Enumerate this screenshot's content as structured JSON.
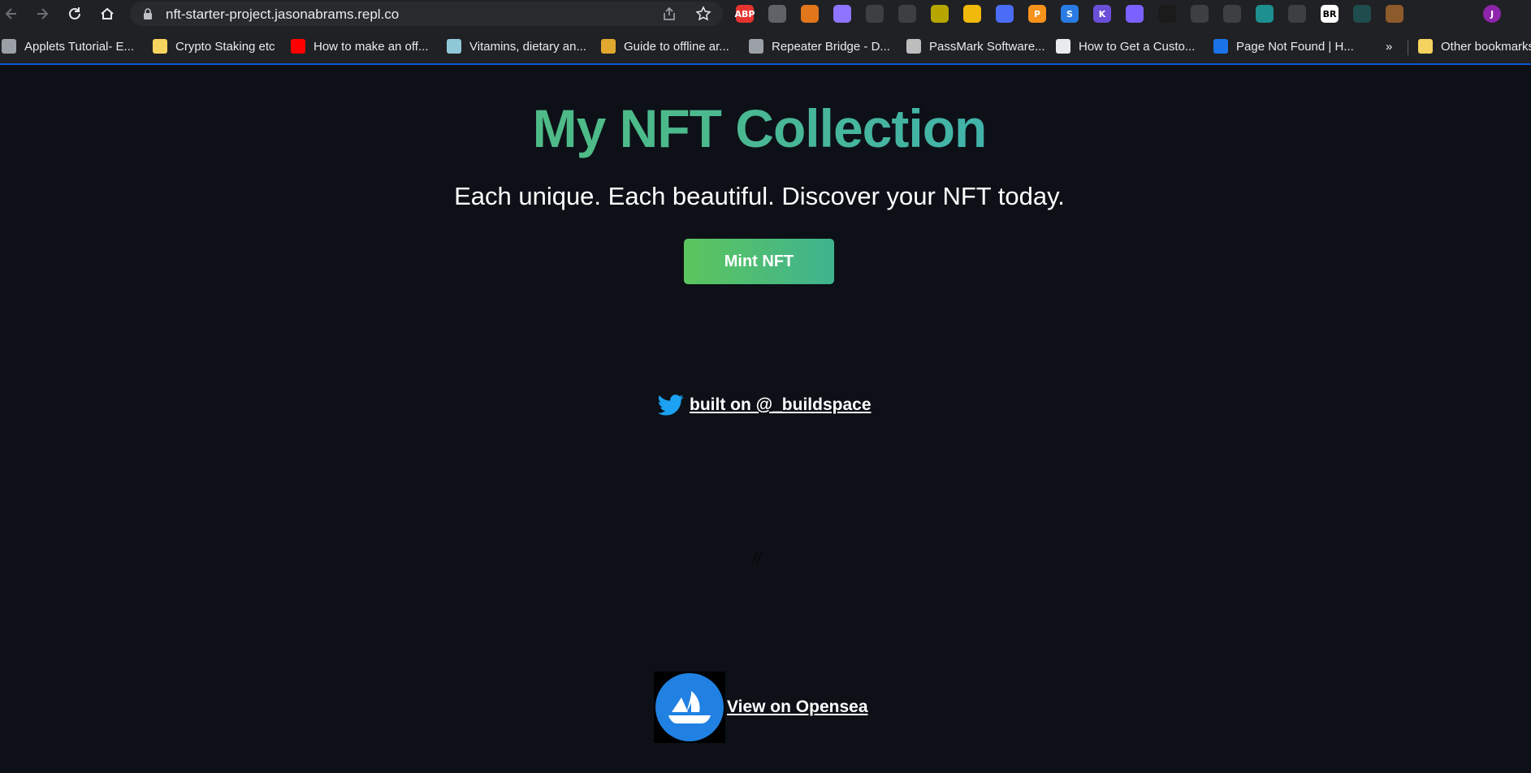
{
  "browser": {
    "url": "nft-starter-project.jasonabrams.repl.co",
    "extensions": [
      {
        "name": "adblock-plus-icon",
        "text": "ABP",
        "color": "#e5342f"
      },
      {
        "name": "extension-icon",
        "text": "",
        "color": "#5f6368"
      },
      {
        "name": "metamask-icon",
        "text": "",
        "color": "#e2761b"
      },
      {
        "name": "github-icon",
        "text": "",
        "color": "#8e75ff"
      },
      {
        "name": "extension-icon",
        "text": "",
        "color": "#3c4043"
      },
      {
        "name": "extension-icon",
        "text": "",
        "color": "#3c4043"
      },
      {
        "name": "extension-icon",
        "text": "",
        "color": "#b7a600"
      },
      {
        "name": "binance-icon",
        "text": "",
        "color": "#f0b90b"
      },
      {
        "name": "extension-icon",
        "text": "",
        "color": "#4a6cf7"
      },
      {
        "name": "extension-icon",
        "text": "P",
        "color": "#f7931a"
      },
      {
        "name": "extension-icon",
        "text": "S",
        "color": "#2a7be4"
      },
      {
        "name": "extension-icon",
        "text": "K",
        "color": "#6b4fd8"
      },
      {
        "name": "extension-icon",
        "text": "",
        "color": "#7b61ff"
      },
      {
        "name": "extension-icon",
        "text": "",
        "color": "#1b1b1b"
      },
      {
        "name": "extension-icon",
        "text": "",
        "color": "#3c4043"
      },
      {
        "name": "extension-icon",
        "text": "",
        "color": "#3c4043"
      },
      {
        "name": "extension-icon",
        "text": "",
        "color": "#1d8f8f"
      },
      {
        "name": "extension-icon",
        "text": "",
        "color": "#3c4043"
      },
      {
        "name": "extension-icon",
        "text": "BR",
        "color": "#ffffff"
      },
      {
        "name": "extension-icon",
        "text": "",
        "color": "#1f4c4c"
      },
      {
        "name": "extension-icon",
        "text": "",
        "color": "#8d5a2b"
      },
      {
        "name": "puzzle-icon",
        "text": "",
        "color": "#202124"
      },
      {
        "name": "side-panel-icon",
        "text": "",
        "color": "#202124"
      },
      {
        "name": "profile-avatar",
        "text": "J",
        "color": "#8e24aa"
      }
    ],
    "bookmarks": [
      {
        "label": "Applets Tutorial- E...",
        "color": "#9aa0a6"
      },
      {
        "label": "Crypto Staking etc",
        "color": "#f4d35e"
      },
      {
        "label": "How to make an off...",
        "color": "#ff0000"
      },
      {
        "label": "Vitamins, dietary an...",
        "color": "#8fc9d8"
      },
      {
        "label": "Guide to offline ar...",
        "color": "#e0a82e"
      },
      {
        "label": "Repeater Bridge - D...",
        "color": "#9aa0a6"
      },
      {
        "label": "PassMark Software...",
        "color": "#bdbdbd"
      },
      {
        "label": "How to Get a Custo...",
        "color": "#e8eaed"
      },
      {
        "label": "Page Not Found | H...",
        "color": "#1a73e8"
      }
    ],
    "more_bookmarks": "»",
    "other_bookmarks": "Other bookmarks"
  },
  "page": {
    "title": "My NFT Collection",
    "subtitle": "Each unique. Each beautiful. Discover your NFT today.",
    "mint_button": "Mint NFT",
    "twitter_link": "built on @_buildspace",
    "slashes": "//",
    "opensea_link": "View on Opensea"
  },
  "colors": {
    "background": "#0d1117",
    "title_gradient_start": "#59c173",
    "title_gradient_end": "#2fa8df",
    "twitter_blue": "#1da1f2",
    "opensea_blue": "#2081e2"
  }
}
